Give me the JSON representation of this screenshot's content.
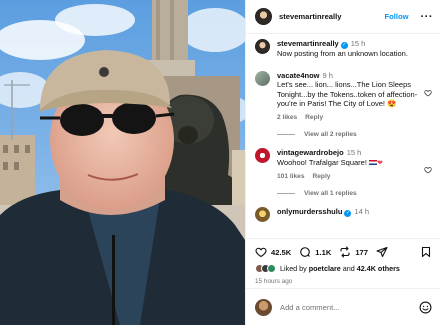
{
  "header": {
    "username": "stevemartinreally",
    "follow_label": "Follow",
    "more_label": "···"
  },
  "caption": {
    "username": "stevemartinreally",
    "time": "15 h",
    "text": "Now posting from an unknown location."
  },
  "comments": [
    {
      "username": "vacate4now",
      "time": "9 h",
      "text": "Let's see... lion... lions...The Lion Sleeps Tonight...by the Tokens..token of affection- you're in Paris! The City of Love! 😍",
      "likes": "2 likes",
      "reply_label": "Reply",
      "view_replies": "View all 2 replies"
    },
    {
      "username": "vintagewardrobejo",
      "time": "15 h",
      "text": "Woohoo! Trafalgar Square!",
      "likes": "101 likes",
      "reply_label": "Reply",
      "view_replies": "View all 1 replies"
    },
    {
      "username": "onlymurdersshulu",
      "time": "14 h"
    }
  ],
  "actions": {
    "likes_count": "42.5K",
    "comments_count": "1.1K",
    "reposts_count": "177",
    "liked_by_prefix": "Liked by",
    "liked_by_user": "poetclare",
    "liked_by_and": "and",
    "liked_by_others": "42.4K others",
    "posted_ago": "15 hours ago"
  },
  "add_comment": {
    "placeholder": "Add a comment..."
  },
  "icons": {
    "like": "heart-icon",
    "comment": "comment-bubble-icon",
    "repost": "repost-icon",
    "share": "send-icon",
    "save": "bookmark-icon",
    "emoji": "emoji-smile-icon"
  },
  "colors": {
    "follow_blue": "#0095f6",
    "muted_text": "#737373",
    "verified_badge": "#0095f6",
    "heart_red": "#ed4956"
  }
}
